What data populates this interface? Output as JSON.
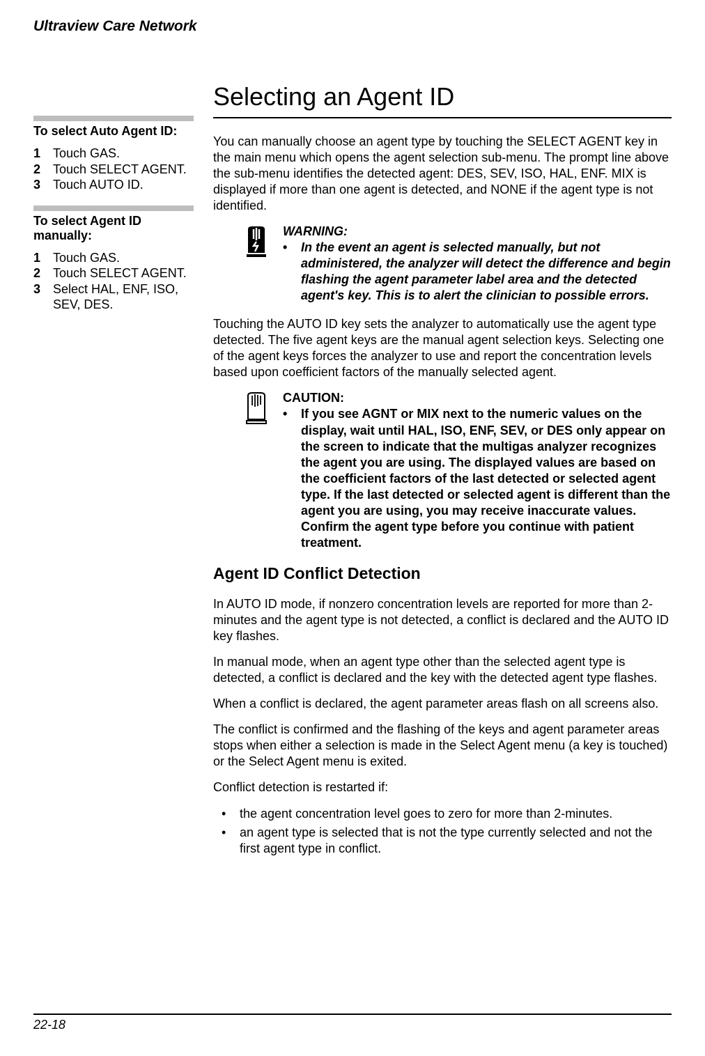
{
  "header": {
    "running_title": "Ultraview Care Network"
  },
  "sidebar": {
    "blocks": [
      {
        "title": "To select Auto Agent ID:",
        "steps": [
          {
            "n": "1",
            "t": "Touch GAS."
          },
          {
            "n": "2",
            "t": "Touch SELECT AGENT."
          },
          {
            "n": "3",
            "t": "Touch AUTO ID."
          }
        ]
      },
      {
        "title": "To select Agent ID manually:",
        "steps": [
          {
            "n": "1",
            "t": "Touch GAS."
          },
          {
            "n": "2",
            "t": "Touch SELECT AGENT."
          },
          {
            "n": "3",
            "t": "Select HAL, ENF, ISO, SEV, DES."
          }
        ]
      }
    ]
  },
  "main": {
    "title": "Selecting an Agent ID",
    "p1": "You can manually choose an agent type by touching the SELECT AGENT key in the main menu which opens the agent selection sub-menu. The prompt line above the sub-menu identifies the detected agent: DES, SEV, ISO, HAL, ENF. MIX is displayed if more than one agent is detected, and NONE if the agent type is not identified.",
    "warning": {
      "label": "WARNING:",
      "text": "In the event an agent is selected manually, but not administered, the analyzer will detect the difference and begin flashing the agent parameter label area and the detected agent's key. This is to alert the clinician to possible errors."
    },
    "p2": "Touching the AUTO ID key sets the analyzer to automatically use the agent type detected. The five agent keys are the manual agent selection keys. Selecting one of the agent keys forces the analyzer to use and report the concentration levels based upon coefficient factors of the manually selected agent.",
    "caution": {
      "label": "CAUTION:",
      "text": "If you see AGNT or MIX next to the numeric values on the display, wait until HAL, ISO, ENF, SEV, or DES only appear on the screen to indicate that the multigas analyzer recognizes the agent you are using. The displayed values are based on the coefficient factors of the last detected or selected agent type. If the last detected or selected agent is different than the agent you are using, you may receive inaccurate values. Confirm the agent type before you continue with patient treatment."
    },
    "h2": "Agent ID Conflict Detection",
    "p3": "In AUTO ID mode, if nonzero concentration levels are reported for more than 2-minutes and the agent type is not detected, a conflict is declared and the AUTO ID key flashes.",
    "p4": "In manual mode, when an agent type other than the selected agent type is detected, a conflict is declared and the key with the detected agent type flashes.",
    "p5": "When a conflict is declared, the agent parameter areas flash on all screens also.",
    "p6": "The conflict is confirmed and the flashing of the keys and agent parameter areas stops when either a selection is made in the Select Agent menu (a key is touched) or the Select Agent menu is exited.",
    "p7": "Conflict detection is restarted if:",
    "bullets": [
      "the agent concentration level goes to zero for more than 2-minutes.",
      "an agent type is selected that is not the type currently selected and not the first agent type in conflict."
    ]
  },
  "footer": {
    "page": "22-18"
  }
}
